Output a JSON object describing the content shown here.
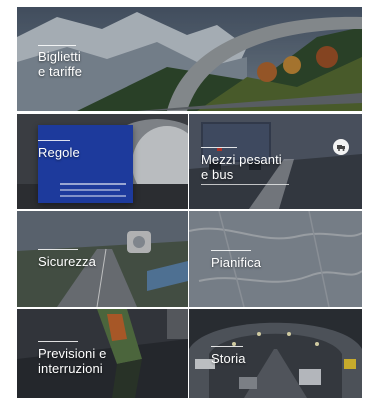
{
  "tiles": {
    "biglietti": {
      "label_line1": "Biglietti",
      "label_line2": "e tariffe"
    },
    "regole": {
      "label": "Regole"
    },
    "mezzi": {
      "label_line1": "Mezzi pesanti",
      "label_line2": "e bus"
    },
    "sicurezza": {
      "label": "Sicurezza"
    },
    "pianifica": {
      "label": "Pianifica"
    },
    "previsioni": {
      "label_line1": "Previsioni e",
      "label_line2": "interruzioni"
    },
    "storia": {
      "label": "Storia"
    }
  },
  "colors": {
    "overlay": "#14181f",
    "blue_card": "#1d3a9c",
    "text": "#ffffff"
  },
  "icons": {
    "mezzi_badge": "truck-icon"
  }
}
